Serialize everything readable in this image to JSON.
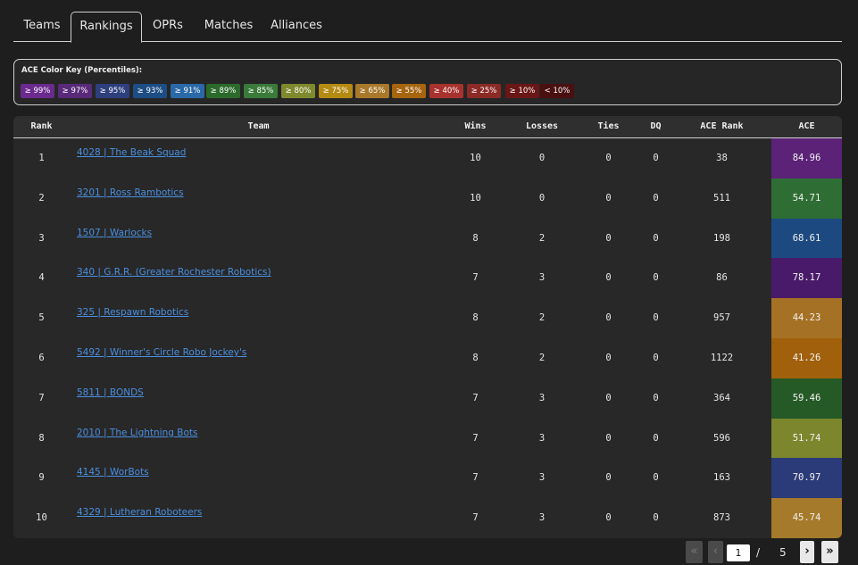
{
  "tabs": [
    {
      "label": "Teams"
    },
    {
      "label": "Rankings"
    },
    {
      "label": "OPRs"
    },
    {
      "label": "Matches"
    },
    {
      "label": "Alliances"
    }
  ],
  "active_tab": "Rankings",
  "color_key": {
    "title": "ACE Color Key (Percentiles):",
    "chips": [
      {
        "label": "≥ 99%",
        "color": "#6a2a8e"
      },
      {
        "label": "≥ 97%",
        "color": "#5a2a7a"
      },
      {
        "label": "≥ 95%",
        "color": "#2e3f7e"
      },
      {
        "label": "≥ 93%",
        "color": "#1d4d85"
      },
      {
        "label": "≥ 91%",
        "color": "#2a69a8"
      },
      {
        "label": "≥ 89%",
        "color": "#2c6a2c"
      },
      {
        "label": "≥ 85%",
        "color": "#3a7a3a"
      },
      {
        "label": "≥ 80%",
        "color": "#7f8a2e"
      },
      {
        "label": "≥ 75%",
        "color": "#b58a12"
      },
      {
        "label": "≥ 65%",
        "color": "#a9782a"
      },
      {
        "label": "≥ 55%",
        "color": "#a6650e"
      },
      {
        "label": "≥ 40%",
        "color": "#a8322e"
      },
      {
        "label": "≥ 25%",
        "color": "#8c2a26"
      },
      {
        "label": "≥ 10%",
        "color": "#6a1616"
      },
      {
        "label": "< 10%",
        "color": "#4a1010"
      }
    ]
  },
  "table": {
    "headers": {
      "rank": "Rank",
      "team": "Team",
      "wins": "Wins",
      "losses": "Losses",
      "ties": "Ties",
      "dq": "DQ",
      "ace_rank": "ACE Rank",
      "ace": "ACE"
    },
    "rows": [
      {
        "rank": "1",
        "team": "4028 | The Beak Squad",
        "wins": "10",
        "losses": "0",
        "ties": "0",
        "dq": "0",
        "ace_rank": "38",
        "ace": "84.96",
        "ace_color": "#5b2278"
      },
      {
        "rank": "2",
        "team": "3201 | Ross Rambotics",
        "wins": "10",
        "losses": "0",
        "ties": "0",
        "dq": "0",
        "ace_rank": "511",
        "ace": "54.71",
        "ace_color": "#2e6e34"
      },
      {
        "rank": "3",
        "team": "1507 | Warlocks",
        "wins": "8",
        "losses": "2",
        "ties": "0",
        "dq": "0",
        "ace_rank": "198",
        "ace": "68.61",
        "ace_color": "#1c4a80"
      },
      {
        "rank": "4",
        "team": "340 | G.R.R. (Greater Rochester Robotics)",
        "wins": "7",
        "losses": "3",
        "ties": "0",
        "dq": "0",
        "ace_rank": "86",
        "ace": "78.17",
        "ace_color": "#4a1a6a"
      },
      {
        "rank": "5",
        "team": "325 | Respawn Robotics",
        "wins": "8",
        "losses": "2",
        "ties": "0",
        "dq": "0",
        "ace_rank": "957",
        "ace": "44.23",
        "ace_color": "#a57124"
      },
      {
        "rank": "6",
        "team": "5492 | Winner's Circle Robo Jockey's",
        "wins": "8",
        "losses": "2",
        "ties": "0",
        "dq": "0",
        "ace_rank": "1122",
        "ace": "41.26",
        "ace_color": "#a1600c"
      },
      {
        "rank": "7",
        "team": "5811 | BONDS",
        "wins": "7",
        "losses": "3",
        "ties": "0",
        "dq": "0",
        "ace_rank": "364",
        "ace": "59.46",
        "ace_color": "#255a26"
      },
      {
        "rank": "8",
        "team": "2010 | The Lightning Bots",
        "wins": "7",
        "losses": "3",
        "ties": "0",
        "dq": "0",
        "ace_rank": "596",
        "ace": "51.74",
        "ace_color": "#7c862c"
      },
      {
        "rank": "9",
        "team": "4145 | WorBots",
        "wins": "7",
        "losses": "3",
        "ties": "0",
        "dq": "0",
        "ace_rank": "163",
        "ace": "70.97",
        "ace_color": "#2b3a78"
      },
      {
        "rank": "10",
        "team": "4329 | Lutheran Roboteers",
        "wins": "7",
        "losses": "3",
        "ties": "0",
        "dq": "0",
        "ace_rank": "873",
        "ace": "45.74",
        "ace_color": "#a57a2a"
      }
    ]
  },
  "pagination": {
    "first_icon": "«",
    "prev_icon": "‹",
    "next_icon": "›",
    "last_icon": "»",
    "current_page": "1",
    "separator": "/",
    "total_pages": "5"
  }
}
